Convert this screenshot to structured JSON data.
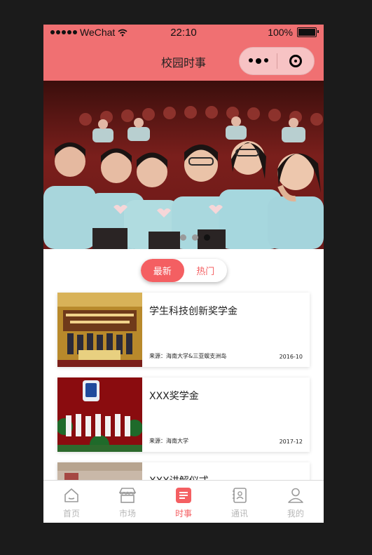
{
  "status_bar": {
    "carrier": "WeChat",
    "time": "22:10",
    "battery": "100%",
    "battery_level": 1.0
  },
  "navbar": {
    "title": "校园时事"
  },
  "banner": {
    "slides": 3,
    "active_index": 2
  },
  "tabs": [
    {
      "label": "最新",
      "active": true
    },
    {
      "label": "热门",
      "active": false
    }
  ],
  "news": [
    {
      "title": "学生科技创新奖学金",
      "source": "来源：海南大学&三亚蜈支洲岛",
      "date": "2016-10"
    },
    {
      "title": "XXX奖学金",
      "source": "来源：海南大学",
      "date": "2017-12"
    },
    {
      "title": "XXX讲解仪式",
      "source": "",
      "date": ""
    }
  ],
  "tabbar": [
    {
      "label": "首页",
      "icon": "home-icon",
      "active": false
    },
    {
      "label": "市场",
      "icon": "store-icon",
      "active": false
    },
    {
      "label": "时事",
      "icon": "news-icon",
      "active": true
    },
    {
      "label": "通讯",
      "icon": "contacts-icon",
      "active": false
    },
    {
      "label": "我的",
      "icon": "user-icon",
      "active": false
    }
  ],
  "colors": {
    "brand": "#f07072",
    "accent": "#f45f62",
    "tab_inactive": "#b7b7b7"
  }
}
